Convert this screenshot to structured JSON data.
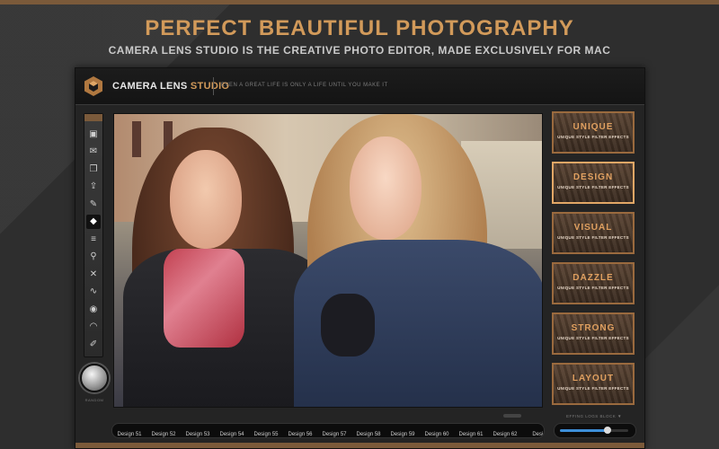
{
  "headline": "PERFECT BEAUTIFUL PHOTOGRAPHY",
  "subheadline": "CAMERA LENS STUDIO IS THE CREATIVE PHOTO EDITOR, MADE EXCLUSIVELY FOR MAC",
  "app": {
    "name_main": "CAMERA LENS ",
    "name_accent": "STUDIO",
    "tagline": "EVEN A GREAT LIFE IS ONLY A LIFE UNTIL YOU MAKE IT",
    "accent_color": "#d29a5a"
  },
  "toolbar": {
    "tools": [
      {
        "name": "photos-icon",
        "glyph": "▣"
      },
      {
        "name": "mail-icon",
        "glyph": "✉"
      },
      {
        "name": "layers-icon",
        "glyph": "❐"
      },
      {
        "name": "share-icon",
        "glyph": "⇪"
      },
      {
        "name": "edit-icon",
        "glyph": "✎"
      },
      {
        "name": "diamond-icon",
        "glyph": "◆"
      },
      {
        "name": "adjustments-icon",
        "glyph": "≡"
      },
      {
        "name": "pin-icon",
        "glyph": "⚲"
      },
      {
        "name": "bandage-icon",
        "glyph": "✕"
      },
      {
        "name": "pulse-icon",
        "glyph": "∿"
      },
      {
        "name": "eye-icon",
        "glyph": "◉"
      },
      {
        "name": "gauge-icon",
        "glyph": "◠"
      },
      {
        "name": "pencil-icon",
        "glyph": "✐"
      }
    ],
    "active_index": 5,
    "knob_label": "RANDOM"
  },
  "styles": [
    {
      "title": "UNIQUE",
      "subtitle": "UNIQUE STYLE FILTER EFFECTS"
    },
    {
      "title": "DESIGN",
      "subtitle": "UNIQUE STYLE FILTER EFFECTS"
    },
    {
      "title": "VISUAL",
      "subtitle": "UNIQUE STYLE FILTER EFFECTS"
    },
    {
      "title": "DAZZLE",
      "subtitle": "UNIQUE STYLE FILTER EFFECTS"
    },
    {
      "title": "STRONG",
      "subtitle": "UNIQUE STYLE FILTER EFFECTS"
    },
    {
      "title": "LAYOUT",
      "subtitle": "UNIQUE STYLE FILTER EFFECTS"
    }
  ],
  "selected_style_index": 1,
  "designs": [
    "Design 51",
    "Design 52",
    "Design 53",
    "Design 54",
    "Design 55",
    "Design 56",
    "Design 57",
    "Design 58",
    "Design 59",
    "Design 60",
    "Design 61",
    "Design 62",
    "Desig"
  ],
  "slider": {
    "label": "EFFING LOGS BLOCK ▼",
    "value_fraction": 0.7,
    "fill_color": "#3d8fd8"
  }
}
